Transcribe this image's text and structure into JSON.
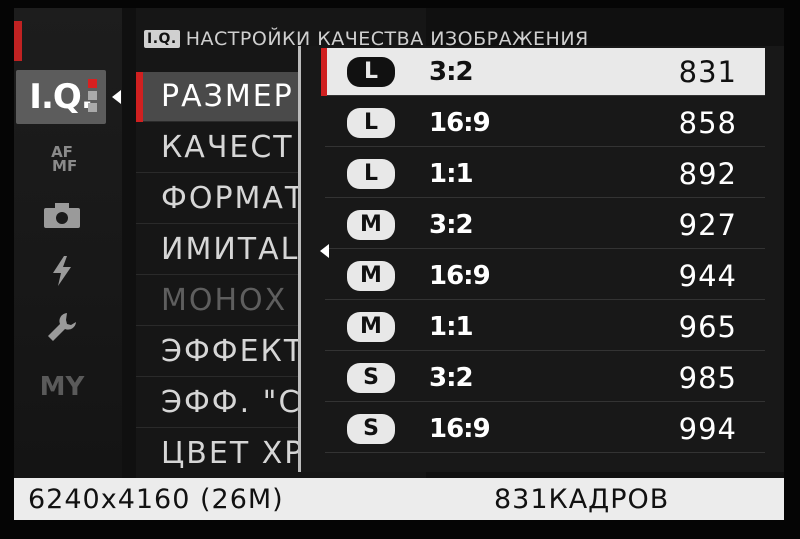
{
  "header": {
    "badge": "I.Q.",
    "title": "НАСТРОЙКИ КАЧЕСТВА ИЗОБРАЖЕНИЯ"
  },
  "sidebar": {
    "items": [
      {
        "label": "I.Q.",
        "icon": "image-quality-icon",
        "active": true
      },
      {
        "label": "AF MF",
        "icon": "focus-icon"
      },
      {
        "label": "",
        "icon": "camera-icon"
      },
      {
        "label": "",
        "icon": "flash-icon"
      },
      {
        "label": "",
        "icon": "wrench-icon"
      },
      {
        "label": "MY",
        "icon": "my-menu-icon"
      }
    ]
  },
  "menu": {
    "items": [
      {
        "label": "РАЗМЕР",
        "selected": true
      },
      {
        "label": "КАЧЕСТ"
      },
      {
        "label": "ФОРМАТ"
      },
      {
        "label": "ИМИТАL"
      },
      {
        "label": "МОНОХ",
        "disabled": true
      },
      {
        "label": "ЭФФЕКТ"
      },
      {
        "label": "ЭФФ. \"С"
      },
      {
        "label": "ЦВЕТ ХР"
      }
    ]
  },
  "popup": {
    "options": [
      {
        "size": "L",
        "ratio": "3:2",
        "count": "831",
        "selected": true
      },
      {
        "size": "L",
        "ratio": "16:9",
        "count": "858"
      },
      {
        "size": "L",
        "ratio": "1:1",
        "count": "892"
      },
      {
        "size": "M",
        "ratio": "3:2",
        "count": "927"
      },
      {
        "size": "M",
        "ratio": "16:9",
        "count": "944"
      },
      {
        "size": "M",
        "ratio": "1:1",
        "count": "965"
      },
      {
        "size": "S",
        "ratio": "3:2",
        "count": "985"
      },
      {
        "size": "S",
        "ratio": "16:9",
        "count": "994"
      }
    ]
  },
  "status": {
    "resolution": "6240x4160 (26M)",
    "frames": "831КАДРОВ"
  },
  "colors": {
    "accent": "#d02020",
    "selection_bg": "#e9e9e9",
    "status_bg": "#ececec"
  }
}
